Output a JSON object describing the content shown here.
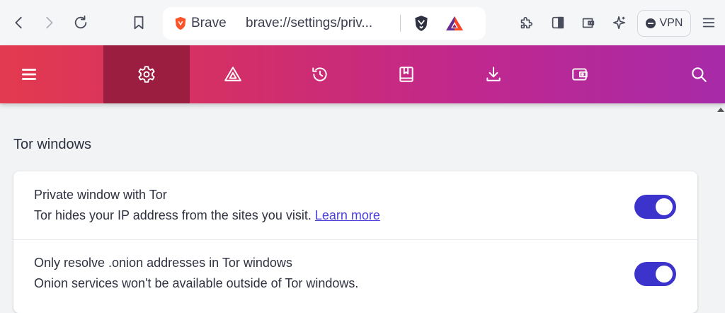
{
  "browser": {
    "brand_name": "Brave",
    "url": "brave://settings/priv...",
    "vpn_label": "VPN",
    "accent_color": "#fb542b"
  },
  "settings_nav": {
    "items": [
      {
        "name": "menu",
        "icon": "hamburger-menu-icon",
        "active": false
      },
      {
        "name": "settings",
        "icon": "gear-icon",
        "active": true
      },
      {
        "name": "rewards",
        "icon": "bat-triangle-icon",
        "active": false
      },
      {
        "name": "history",
        "icon": "history-icon",
        "active": false
      },
      {
        "name": "bookmarks",
        "icon": "bookmarks-icon",
        "active": false
      },
      {
        "name": "downloads",
        "icon": "download-icon",
        "active": false
      },
      {
        "name": "wallet",
        "icon": "wallet-icon",
        "active": false
      },
      {
        "name": "search",
        "icon": "search-icon",
        "active": false
      }
    ]
  },
  "section": {
    "title": "Tor windows",
    "rows": [
      {
        "title": "Private window with Tor",
        "description": "Tor hides your IP address from the sites you visit.",
        "link": "Learn more",
        "enabled": true
      },
      {
        "title": "Only resolve .onion addresses in Tor windows",
        "description": "Onion services won't be available outside of Tor windows.",
        "enabled": true
      }
    ]
  }
}
